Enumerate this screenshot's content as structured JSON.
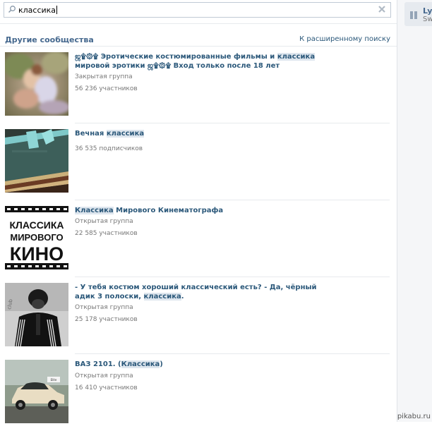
{
  "search": {
    "value": "классика",
    "clear_icon": "close-icon",
    "search_icon": "search-icon"
  },
  "section": {
    "title": "Другие сообщества",
    "advanced_link": "К расширенному поиску"
  },
  "player": {
    "title": "Ly",
    "subtitle": "Sw",
    "icon": "pause-icon"
  },
  "results": [
    {
      "title_parts": [
        "ஜ۩۞۩ Эротические костюмированные фильмы и ",
        "классика",
        " мировой эротики ஜ۩۞۩ Вход только после 18 лет"
      ],
      "type": "Закрытая группа",
      "members": "56 236 участников",
      "image": "romantic-couple-photo"
    },
    {
      "title_parts": [
        "Вечная ",
        "классика",
        ""
      ],
      "type": "",
      "members": "36 535 подписчиков",
      "image": "old-books-photo"
    },
    {
      "title_parts": [
        "",
        "Классика",
        " Мирового Кинематографа"
      ],
      "type": "Открытая группа",
      "members": "22 585 участников",
      "image": "film-logo",
      "logo_lines": [
        "КЛАССИКА",
        "МИРОВОГО",
        "КИНО"
      ]
    },
    {
      "title_parts": [
        "- У тебя костюм хороший классический есть? - Да, чёрный адик 3 полоски, ",
        "классика",
        "."
      ],
      "type": "Открытая группа",
      "members": "25 178 участников",
      "image": "tracksuit-man-photo"
    },
    {
      "title_parts": [
        "ВАЗ 2101. (",
        "Классика",
        ")"
      ],
      "type": "Открытая группа",
      "members": "16 410 участников",
      "image": "vaz-car-photo"
    }
  ],
  "watermark": "pikabu.ru",
  "colors": {
    "link": "#2b587a",
    "header": "#45688e",
    "muted": "#777777",
    "highlight": "#dee6ee"
  }
}
